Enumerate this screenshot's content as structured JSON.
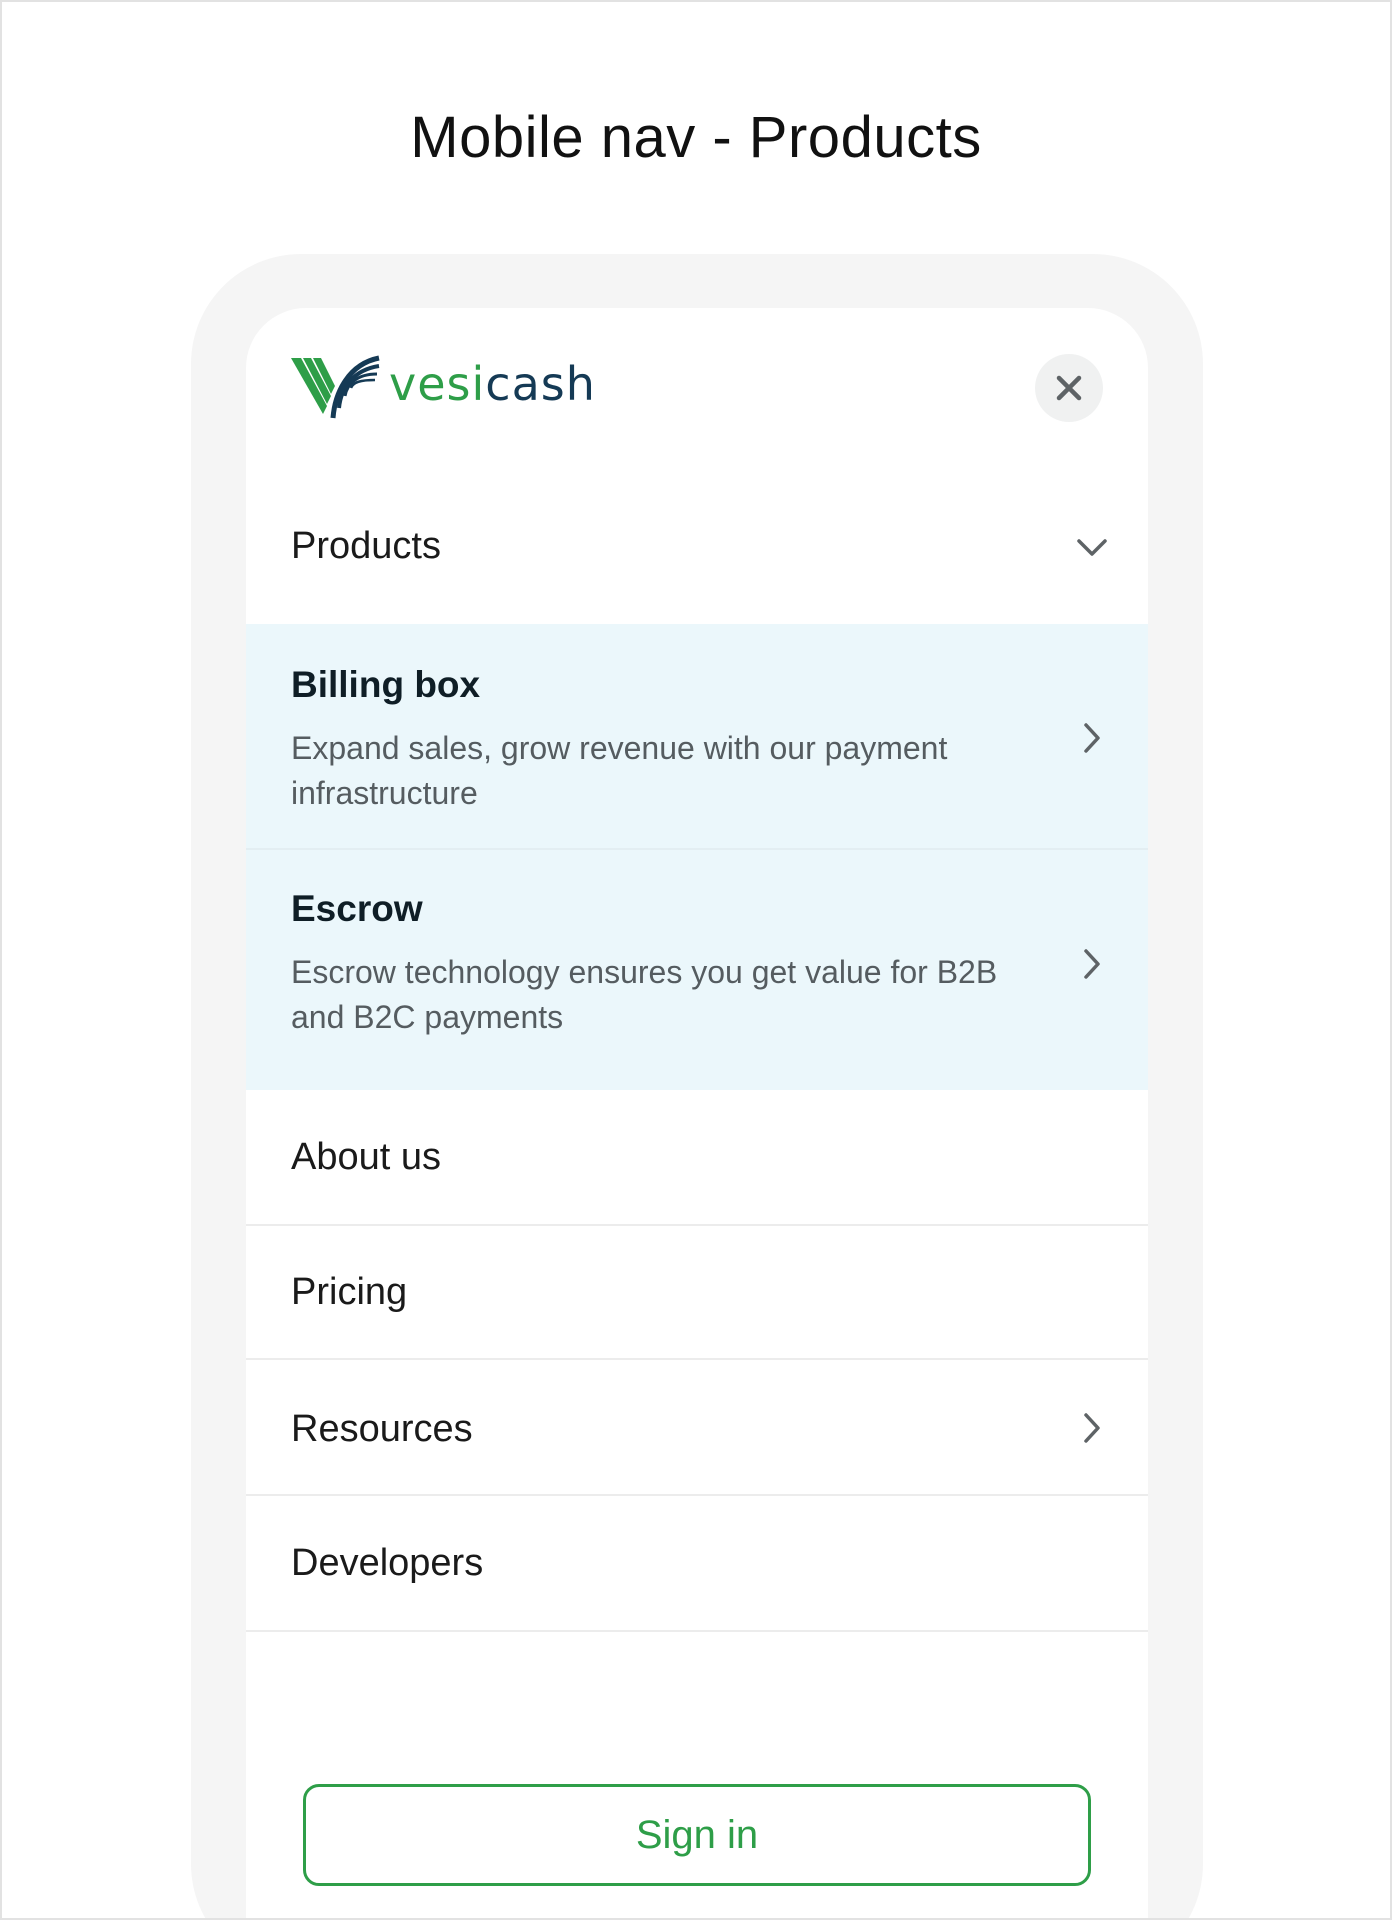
{
  "page_title": "Mobile nav - Products",
  "brand": {
    "logo_name_green": "vesi",
    "logo_name_navy": "cash",
    "colors": {
      "green": "#2e9e48",
      "navy": "#153a55"
    }
  },
  "header": {
    "close_icon": "close-icon"
  },
  "nav": {
    "products": {
      "label": "Products",
      "icon": "chevron-down-icon"
    },
    "submenu": [
      {
        "title": "Billing box",
        "desc": "Expand sales, grow revenue with our payment infrastructure",
        "icon": "chevron-right-icon"
      },
      {
        "title": "Escrow",
        "desc": "Escrow technology ensures you get value for B2B and B2C payments",
        "icon": "chevron-right-icon"
      }
    ],
    "items": [
      {
        "label": "About us"
      },
      {
        "label": "Pricing"
      },
      {
        "label": "Resources",
        "icon": "chevron-right-icon"
      },
      {
        "label": "Developers"
      }
    ]
  },
  "signin_label": "Sign in",
  "colors": {
    "submenu_bg": "#ebf7fb",
    "phone_frame": "#f5f5f5",
    "close_bg": "#f0f1f1"
  }
}
